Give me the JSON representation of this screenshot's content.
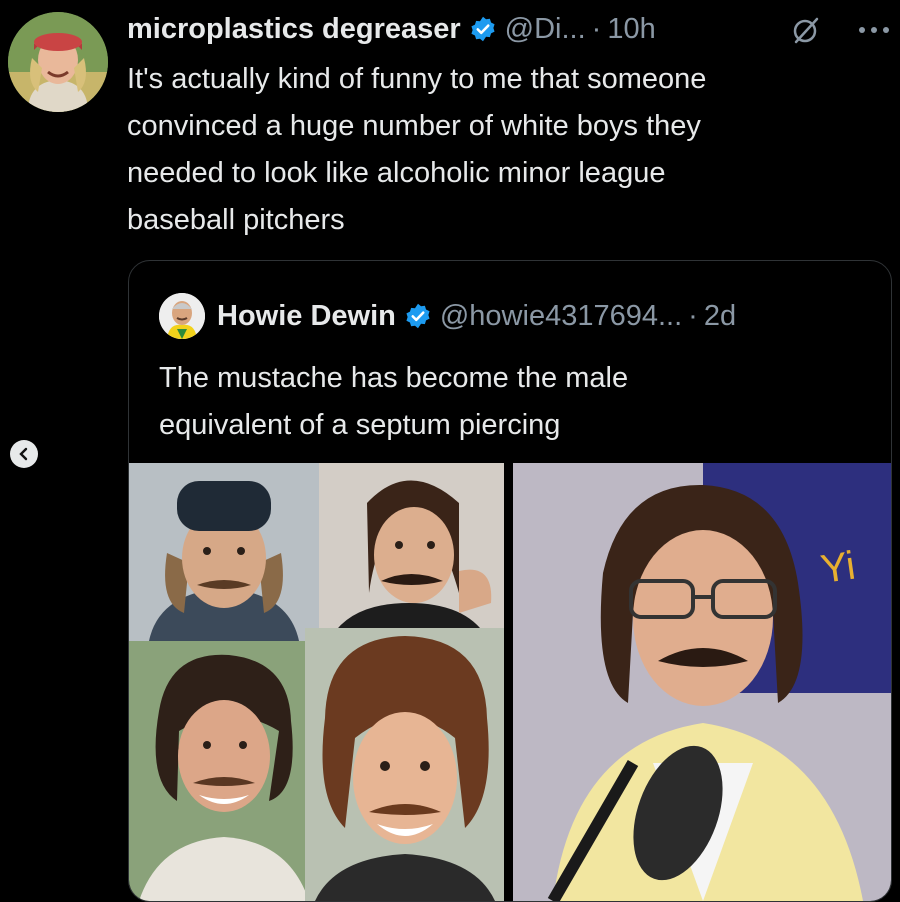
{
  "tweet": {
    "display_name": "microplastics degreaser",
    "handle": "@Di...",
    "separator": "·",
    "time": "10h",
    "text_lines": [
      "It's actually kind of funny to me that someone",
      "convinced a huge number of white boys they",
      "needed to look like alcoholic minor league",
      "baseball pitchers"
    ]
  },
  "quote": {
    "display_name": "Howie Dewin",
    "handle": "@howie4317694...",
    "separator": "·",
    "time": "2d",
    "text_lines": [
      "The mustache has become the male",
      "equivalent of a septum piercing"
    ]
  },
  "colors": {
    "background": "#000000",
    "text": "#e7e9ea",
    "secondary": "#8b98a5",
    "verified": "#1d9bf0",
    "border": "#2f3336"
  },
  "icons": [
    "verified-badge-icon",
    "grok-icon",
    "more-icon",
    "prev-arrow-icon",
    "next-arrow-icon"
  ]
}
